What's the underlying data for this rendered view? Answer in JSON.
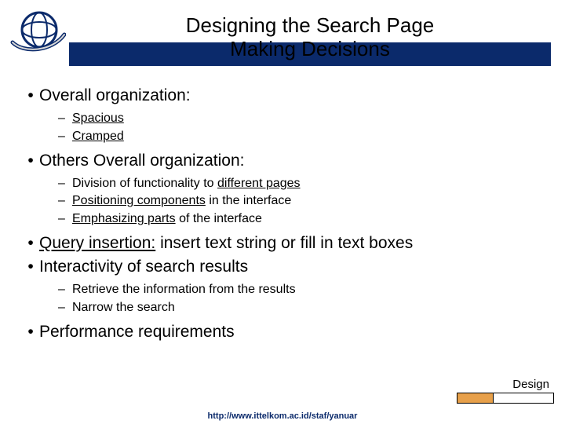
{
  "title": "Designing the Search Page\nMaking Decisions",
  "bullets": [
    {
      "segments": [
        {
          "t": "Overall organization:",
          "u": false
        }
      ],
      "sub": [
        {
          "segments": [
            {
              "t": "Spacious",
              "u": true
            }
          ]
        },
        {
          "segments": [
            {
              "t": "Cramped",
              "u": true
            }
          ]
        }
      ]
    },
    {
      "segments": [
        {
          "t": "Others Overall organization:",
          "u": false
        }
      ],
      "sub": [
        {
          "segments": [
            {
              "t": "Division of functionality to ",
              "u": false
            },
            {
              "t": "different pages",
              "u": true
            }
          ]
        },
        {
          "segments": [
            {
              "t": "Positioning components",
              "u": true
            },
            {
              "t": " in the interface",
              "u": false
            }
          ]
        },
        {
          "segments": [
            {
              "t": "Emphasizing parts",
              "u": true
            },
            {
              "t": " of the interface",
              "u": false
            }
          ]
        }
      ]
    },
    {
      "segments": [
        {
          "t": "Query insertion:",
          "u": true
        },
        {
          "t": " insert text string or fill in text boxes",
          "u": false
        }
      ],
      "sub": []
    },
    {
      "segments": [
        {
          "t": "Interactivity of search results",
          "u": false
        }
      ],
      "sub": [
        {
          "segments": [
            {
              "t": "Retrieve the information from the results",
              "u": false
            }
          ]
        },
        {
          "segments": [
            {
              "t": "Narrow the search",
              "u": false
            }
          ]
        }
      ]
    },
    {
      "segments": [
        {
          "t": "Performance requirements",
          "u": false
        }
      ],
      "sub": []
    }
  ],
  "footer_label": "Design",
  "footer_url": "http://www.ittelkom.ac.id/staf/yanuar",
  "colors": {
    "brand": "#0b2a6b",
    "accent": "#e7a04a"
  }
}
